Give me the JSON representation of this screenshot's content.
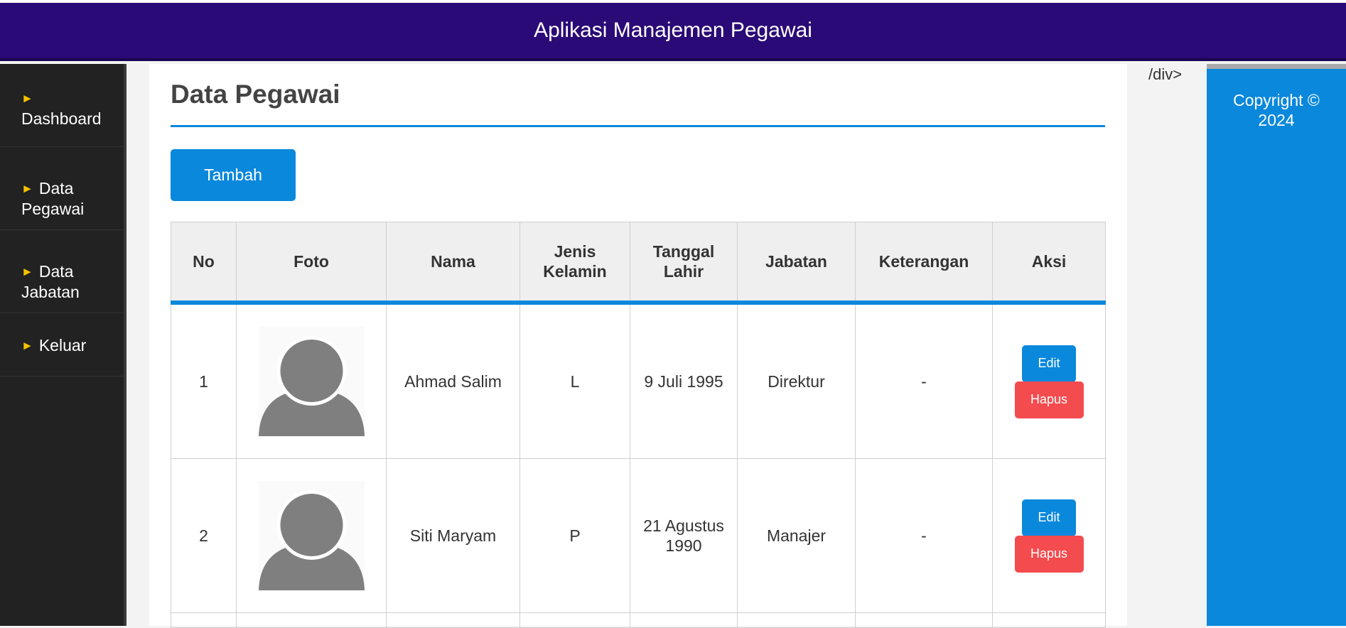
{
  "header": {
    "title": "Aplikasi Manajemen Pegawai"
  },
  "sidebar": {
    "items": [
      {
        "label": "Dashboard"
      },
      {
        "label": "Data Pegawai"
      },
      {
        "label": "Data Jabatan"
      },
      {
        "label": "Keluar"
      }
    ]
  },
  "main": {
    "title": "Data Pegawai",
    "add_button": "Tambah",
    "table": {
      "headers": [
        "No",
        "Foto",
        "Nama",
        "Jenis Kelamin",
        "Tanggal Lahir",
        "Jabatan",
        "Keterangan",
        "Aksi"
      ],
      "rows": [
        {
          "no": "1",
          "nama": "Ahmad Salim",
          "jenis_kelamin": "L",
          "tanggal_lahir": "9 Juli 1995",
          "jabatan": "Direktur",
          "keterangan": "-",
          "edit": "Edit",
          "hapus": "Hapus"
        },
        {
          "no": "2",
          "nama": "Siti Maryam",
          "jenis_kelamin": "P",
          "tanggal_lahir": "21 Agustus 1990",
          "jabatan": "Manajer",
          "keterangan": "-",
          "edit": "Edit",
          "hapus": "Hapus"
        }
      ]
    }
  },
  "stray_text": "/div>",
  "footer": {
    "copyright": "Copyright © 2024"
  },
  "colors": {
    "header_bg": "#2a0a76",
    "accent": "#0a88dc",
    "danger": "#f44b4f",
    "sidebar_bg": "#222222",
    "arrow": "#f5c400"
  },
  "icons": {
    "nav_arrow": "triangle-right-icon",
    "photo": "user-avatar-icon"
  }
}
